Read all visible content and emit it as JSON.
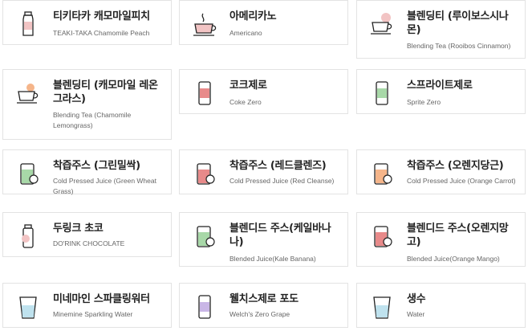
{
  "menu": {
    "items": [
      {
        "name": "티키타카 캐모마일피치",
        "sub": "TEAKI-TAKA Chamomile Peach",
        "icon": "bottle-icon"
      },
      {
        "name": "아메리카노",
        "sub": "Americano",
        "icon": "coffee-cup-icon"
      },
      {
        "name": "블렌딩티 (루이보스시나몬)",
        "sub": "Blending Tea (Rooibos Cinnamon)",
        "icon": "tea-cup-icon"
      },
      {
        "name": "블렌딩티 (캐모마일 레온그라스)",
        "sub": "Blending Tea (Chamomile Lemongrass)",
        "icon": "tea-cup-icon"
      },
      {
        "name": "코크제로",
        "sub": "Coke Zero",
        "icon": "can-icon"
      },
      {
        "name": "스프라이트제로",
        "sub": "Sprite Zero",
        "icon": "can-icon"
      },
      {
        "name": "착즙주스 (그린밀싹)",
        "sub": "Cold Pressed Juice (Green Wheat Grass)",
        "icon": "juice-jar-icon"
      },
      {
        "name": "착즙주스 (레드클렌즈)",
        "sub": "Cold Pressed Juice (Red Cleanse)",
        "icon": "juice-jar-icon"
      },
      {
        "name": "착즙주스 (오렌지당근)",
        "sub": "Cold Pressed Juice (Orange Carrot)",
        "icon": "juice-jar-icon"
      },
      {
        "name": "두링크 초코",
        "sub": "DO'RINK CHOCOLATE",
        "icon": "drink-bottle-icon"
      },
      {
        "name": "블렌디드 주스(케일바나나)",
        "sub": "Blended Juice(Kale Banana)",
        "icon": "juice-jar-icon"
      },
      {
        "name": "블렌디드 주스(오렌지망고)",
        "sub": "Blended Juice(Orange Mango)",
        "icon": "juice-jar-icon"
      },
      {
        "name": "미네마인 스파클링워터",
        "sub": "Minemine Sparkling Water",
        "icon": "water-glass-icon"
      },
      {
        "name": "웰치스제로 포도",
        "sub": "Welch's Zero Grape",
        "icon": "can-icon"
      },
      {
        "name": "생수",
        "sub": "Water",
        "icon": "water-glass-icon"
      }
    ]
  },
  "colors": {
    "border": "#e3e3e3",
    "text": "#222222",
    "subtext": "#666666",
    "accent_pink": "#f2c4c4",
    "accent_green": "#a8d8a8",
    "accent_red": "#e88a8a",
    "accent_orange": "#f5b58a",
    "accent_purple": "#c9b6e6",
    "accent_blue": "#bfe2ee"
  }
}
